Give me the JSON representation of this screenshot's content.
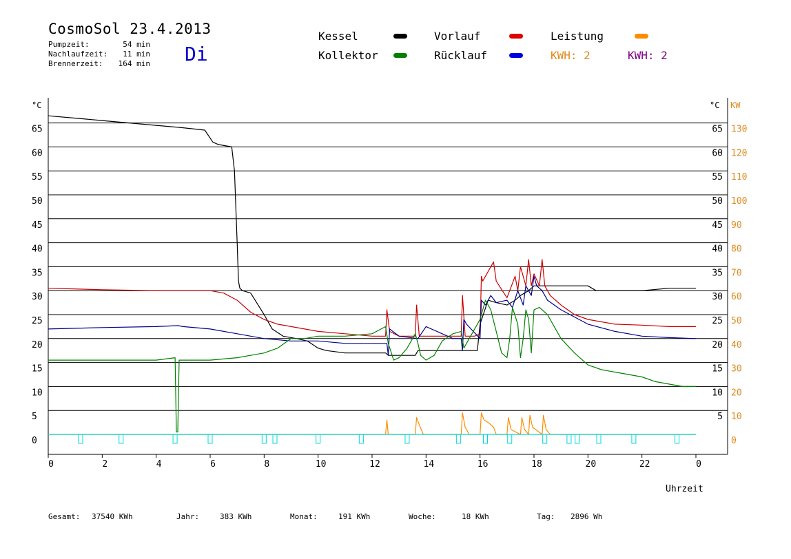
{
  "header": {
    "title": "CosmoSol 23.4.2013",
    "weekday": "Di",
    "stats": [
      {
        "label": "Pumpzeit:",
        "value": "54 min"
      },
      {
        "label": "Nachlaufzeit:",
        "value": "11 min"
      },
      {
        "label": "Brennerzeit:",
        "value": "164 min"
      }
    ]
  },
  "legend": {
    "kessel": "Kessel",
    "vorlauf": "Vorlauf",
    "leistung": "Leistung",
    "kollektor": "Kollektor",
    "ruecklauf": "Rücklauf",
    "kwh1": "KWH: 2",
    "kwh2": "KWH: 2"
  },
  "colors": {
    "kessel": "#000000",
    "vorlauf": "#cc0000",
    "ruecklauf": "#00008b",
    "kollektor": "#008000",
    "leistung": "#ff8c00",
    "pumpe": "#00d8d8",
    "kwh1": "#e08a1e",
    "kwh2": "#800080",
    "axis_right_kw": "#e08a1e",
    "grid": "#000000"
  },
  "footer": [
    {
      "label": "Gesamt:",
      "value": "37540 KWh"
    },
    {
      "label": "Jahr:",
      "value": "383 KWh"
    },
    {
      "label": "Monat:",
      "value": "191 KWh"
    },
    {
      "label": "Woche:",
      "value": "18 KWh"
    },
    {
      "label": "Tag:",
      "value": "2896 Wh"
    }
  ],
  "chart_data": {
    "type": "line",
    "xlabel": "Uhrzeit",
    "ylabel": "°C",
    "ylabel_right": "KW",
    "x_ticks": [
      "0",
      "2",
      "4",
      "6",
      "8",
      "10",
      "12",
      "14",
      "16",
      "18",
      "20",
      "22",
      "0"
    ],
    "xlim": [
      0,
      24
    ],
    "ylim": [
      0,
      65
    ],
    "y_ticks_left": [
      "0",
      "5",
      "10",
      "15",
      "20",
      "25",
      "30",
      "35",
      "40",
      "45",
      "50",
      "55",
      "60",
      "65"
    ],
    "y_ticks_right_c": [
      "5",
      "10",
      "15",
      "20",
      "25",
      "30",
      "35",
      "40",
      "45",
      "50",
      "55",
      "60",
      "65"
    ],
    "y_ticks_right_kw": [
      "0",
      "10",
      "20",
      "30",
      "40",
      "50",
      "60",
      "70",
      "80",
      "90",
      "100",
      "110",
      "120",
      "130"
    ],
    "grid": true,
    "series": [
      {
        "name": "Kessel",
        "key": "kessel",
        "x": [
          0,
          1,
          2,
          3,
          4,
          5,
          5.8,
          6.1,
          6.3,
          6.8,
          6.9,
          7.0,
          7.05,
          7.1,
          7.2,
          7.5,
          8.0,
          8.3,
          8.7,
          9.2,
          9.6,
          10.0,
          10.3,
          11.0,
          12.0,
          12.5,
          12.6,
          13.0,
          13.6,
          13.7,
          14.0,
          15.0,
          15.3,
          15.5,
          15.9,
          16.0,
          16.3,
          16.6,
          17.0,
          17.3,
          17.5,
          17.8,
          18.0,
          18.3,
          19.0,
          20.0,
          20.3,
          21.0,
          22.0,
          23.0,
          24.0
        ],
        "y": [
          66.5,
          66.0,
          65.5,
          65.0,
          64.5,
          64.0,
          63.5,
          61.0,
          60.5,
          60.0,
          55.0,
          40.0,
          32.0,
          30.5,
          30.0,
          29.5,
          25.0,
          22.0,
          20.5,
          20.0,
          19.5,
          18.0,
          17.5,
          17.0,
          17.0,
          17.0,
          16.5,
          16.5,
          16.5,
          17.5,
          17.5,
          17.5,
          17.5,
          17.5,
          17.5,
          23.0,
          28.0,
          27.5,
          27.0,
          28.0,
          29.0,
          30.0,
          31.0,
          31.0,
          31.0,
          31.0,
          30.0,
          30.0,
          30.0,
          30.5,
          30.5
        ]
      },
      {
        "name": "Vorlauf",
        "key": "vorlauf",
        "x": [
          0,
          2,
          4,
          6,
          6.5,
          7.0,
          7.5,
          8.0,
          8.5,
          9.0,
          10.0,
          11.0,
          12.0,
          12.5,
          12.55,
          12.65,
          13.0,
          13.6,
          13.65,
          13.75,
          14.0,
          15.0,
          15.3,
          15.35,
          15.45,
          15.8,
          16.0,
          16.05,
          16.1,
          16.3,
          16.5,
          16.6,
          17.0,
          17.3,
          17.4,
          17.5,
          17.7,
          17.8,
          17.9,
          18.0,
          18.2,
          18.3,
          18.4,
          18.6,
          19.0,
          19.5,
          20.0,
          21.0,
          22.0,
          23.0,
          24.0
        ],
        "y": [
          30.5,
          30.2,
          30.0,
          30.0,
          29.5,
          28.0,
          25.5,
          24.0,
          23.0,
          22.5,
          21.5,
          21.0,
          20.5,
          20.5,
          26.0,
          21.5,
          20.5,
          20.5,
          27.0,
          20.5,
          20.5,
          20.5,
          20.5,
          29.0,
          20.5,
          20.5,
          21.0,
          33.0,
          32.0,
          34.0,
          36.0,
          32.0,
          28.5,
          33.0,
          30.0,
          35.0,
          31.0,
          36.5,
          31.0,
          33.5,
          31.0,
          36.5,
          31.0,
          29.0,
          27.0,
          25.0,
          24.0,
          23.0,
          22.8,
          22.5,
          22.5
        ]
      },
      {
        "name": "Rücklauf",
        "key": "ruecklauf",
        "x": [
          0,
          2,
          4,
          4.8,
          5,
          6,
          7,
          8,
          9,
          10,
          11,
          12,
          12.55,
          12.6,
          12.65,
          13,
          13.7,
          14,
          15,
          15.3,
          15.35,
          15.4,
          15.5,
          16,
          16.05,
          16.2,
          16.4,
          16.6,
          17,
          17.2,
          17.4,
          17.6,
          17.7,
          17.9,
          18,
          18.1,
          18.3,
          18.5,
          19,
          20,
          21,
          22,
          23,
          24
        ],
        "y": [
          22.0,
          22.3,
          22.5,
          22.7,
          22.5,
          22.0,
          21.0,
          20.0,
          19.5,
          19.5,
          19.0,
          19.0,
          19.0,
          16.5,
          22.0,
          20.5,
          20.0,
          22.5,
          20.0,
          20.0,
          17.5,
          24.0,
          23.0,
          20.0,
          28.0,
          27.0,
          29.0,
          27.5,
          28.0,
          26.5,
          30.0,
          27.0,
          31.0,
          29.0,
          33.0,
          31.0,
          30.0,
          28.0,
          26.0,
          23.0,
          21.5,
          20.5,
          20.2,
          20.0
        ]
      },
      {
        "name": "Kollektor",
        "key": "kollektor",
        "x": [
          0,
          1,
          2,
          3,
          4,
          4.7,
          4.75,
          4.8,
          4.85,
          4.9,
          5,
          6,
          7,
          8,
          8.5,
          9,
          9.5,
          10,
          11,
          12,
          12.5,
          12.6,
          12.8,
          13,
          13.3,
          13.6,
          13.7,
          13.8,
          14,
          14.3,
          14.6,
          15,
          15.3,
          15.4,
          15.6,
          15.8,
          16,
          16.2,
          16.4,
          16.6,
          16.8,
          17,
          17.1,
          17.2,
          17.4,
          17.5,
          17.6,
          17.7,
          17.8,
          17.9,
          18,
          18.2,
          18.5,
          18.8,
          19,
          19.5,
          20,
          20.5,
          21,
          21.5,
          22,
          22.5,
          23,
          23.5,
          24
        ],
        "y": [
          15.5,
          15.5,
          15.5,
          15.5,
          15.5,
          16.0,
          0.5,
          0.5,
          15.5,
          15.5,
          15.5,
          15.5,
          16.0,
          17.0,
          18.0,
          20.0,
          20.0,
          20.5,
          20.5,
          21.0,
          22.5,
          19.0,
          15.5,
          16.0,
          18.0,
          21.0,
          19.0,
          16.5,
          15.5,
          16.5,
          19.5,
          21.0,
          21.5,
          18.0,
          20.0,
          22.0,
          24.0,
          28.0,
          26.0,
          21.5,
          17.0,
          16.0,
          20.0,
          26.5,
          23.0,
          16.0,
          20.0,
          26.0,
          24.0,
          17.0,
          26.0,
          26.5,
          25.0,
          22.0,
          20.0,
          17.0,
          14.5,
          13.5,
          13.0,
          12.5,
          12.0,
          11.0,
          10.5,
          10.0,
          10.0
        ]
      },
      {
        "name": "Leistung",
        "key": "leistung",
        "x": [
          0,
          12.5,
          12.55,
          12.6,
          13.6,
          13.65,
          13.75,
          13.9,
          15.3,
          15.35,
          15.45,
          15.6,
          16.0,
          16.05,
          16.15,
          16.3,
          16.5,
          16.6,
          17.0,
          17.05,
          17.15,
          17.5,
          17.55,
          17.65,
          17.8,
          17.85,
          17.95,
          18.3,
          18.35,
          18.45,
          18.6,
          24
        ],
        "y": [
          0,
          0,
          3,
          0,
          0,
          3.5,
          2.0,
          0,
          0,
          4.5,
          1.5,
          0,
          0,
          4.5,
          3.0,
          2.5,
          1.5,
          0,
          0,
          3.5,
          1.0,
          0,
          3.5,
          1.0,
          0,
          4.0,
          1.5,
          0,
          4.0,
          1.0,
          0,
          0
        ]
      },
      {
        "name": "Pumpe",
        "key": "pumpe",
        "x": [
          0,
          24
        ],
        "y": [
          0,
          0
        ]
      }
    ],
    "pump_markers_x": [
      1.2,
      2.7,
      4.7,
      6.0,
      8.0,
      8.4,
      10.0,
      11.6,
      13.3,
      15.2,
      16.2,
      17.1,
      18.4,
      19.3,
      19.6,
      20.4,
      21.7,
      23.3
    ]
  }
}
